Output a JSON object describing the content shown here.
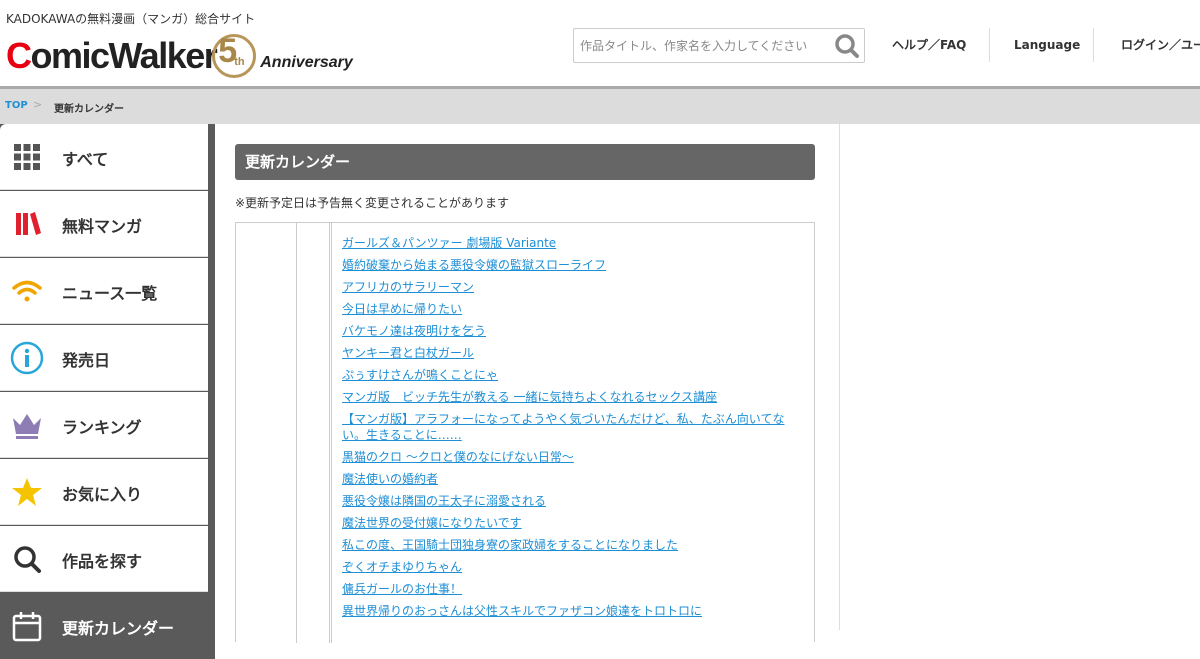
{
  "header": {
    "tagline": "KADOKAWAの無料漫画（マンガ）総合サイト",
    "logo": {
      "brand_red": "C",
      "brand_rest": "omicWalker",
      "anniv_number": "5",
      "anniv_suffix": "th",
      "anniv_word": "Anniversary"
    },
    "search": {
      "placeholder": "作品タイトル、作家名を入力してください",
      "icon": "search-icon"
    },
    "nav": {
      "help": "ヘルプ／FAQ",
      "language": "Language",
      "login": "ログイン／ユーザー登録"
    }
  },
  "breadcrumb": {
    "top": "TOP",
    "separator": ">",
    "current": "更新カレンダー"
  },
  "sidebar": {
    "items": [
      {
        "label": "すべて",
        "icon": "grid-icon"
      },
      {
        "label": "無料マンガ",
        "icon": "books-icon"
      },
      {
        "label": "ニュース一覧",
        "icon": "wifi-icon"
      },
      {
        "label": "発売日",
        "icon": "info-icon"
      },
      {
        "label": "ランキング",
        "icon": "crown-icon"
      },
      {
        "label": "お気に入り",
        "icon": "star-icon"
      },
      {
        "label": "作品を探す",
        "icon": "search-icon"
      },
      {
        "label": "更新カレンダー",
        "icon": "calendar-icon"
      }
    ]
  },
  "main": {
    "title": "更新カレンダー",
    "notice": "※更新予定日は予告無く変更されることがあります",
    "titles": [
      "ガールズ＆パンツァー 劇場版 Variante",
      "婚約破棄から始まる悪役令嬢の監獄スローライフ",
      "アフリカのサラリーマン",
      "今日は早めに帰りたい",
      "バケモノ達は夜明けを乞う",
      "ヤンキー君と白杖ガール",
      "ぷぅすけさんが鳴くことにゃ",
      "マンガ版　ビッチ先生が教える 一緒に気持ちよくなれるセックス講座",
      "【マンガ版】アラフォーになってようやく気づいたんだけど、私、たぶん向いてない。生きることに……",
      "黒猫のクロ ～クロと僕のなにげない日常～",
      "魔法使いの婚約者",
      "悪役令嬢は隣国の王太子に溺愛される",
      "魔法世界の受付嬢になりたいです",
      "私この度、王国騎士団独身寮の家政婦をすることになりました",
      "ぞくオチまゆりちゃん",
      "傭兵ガールのお仕事！",
      "異世界帰りのおっさんは父性スキルでファザコン娘達をトロトロに"
    ]
  },
  "colors": {
    "brand_red": "#e60012",
    "link": "#1e8fd5",
    "anniv_gold": "#a88748",
    "sidebar_dark": "#5a5a5a",
    "title_bar": "#666666"
  }
}
